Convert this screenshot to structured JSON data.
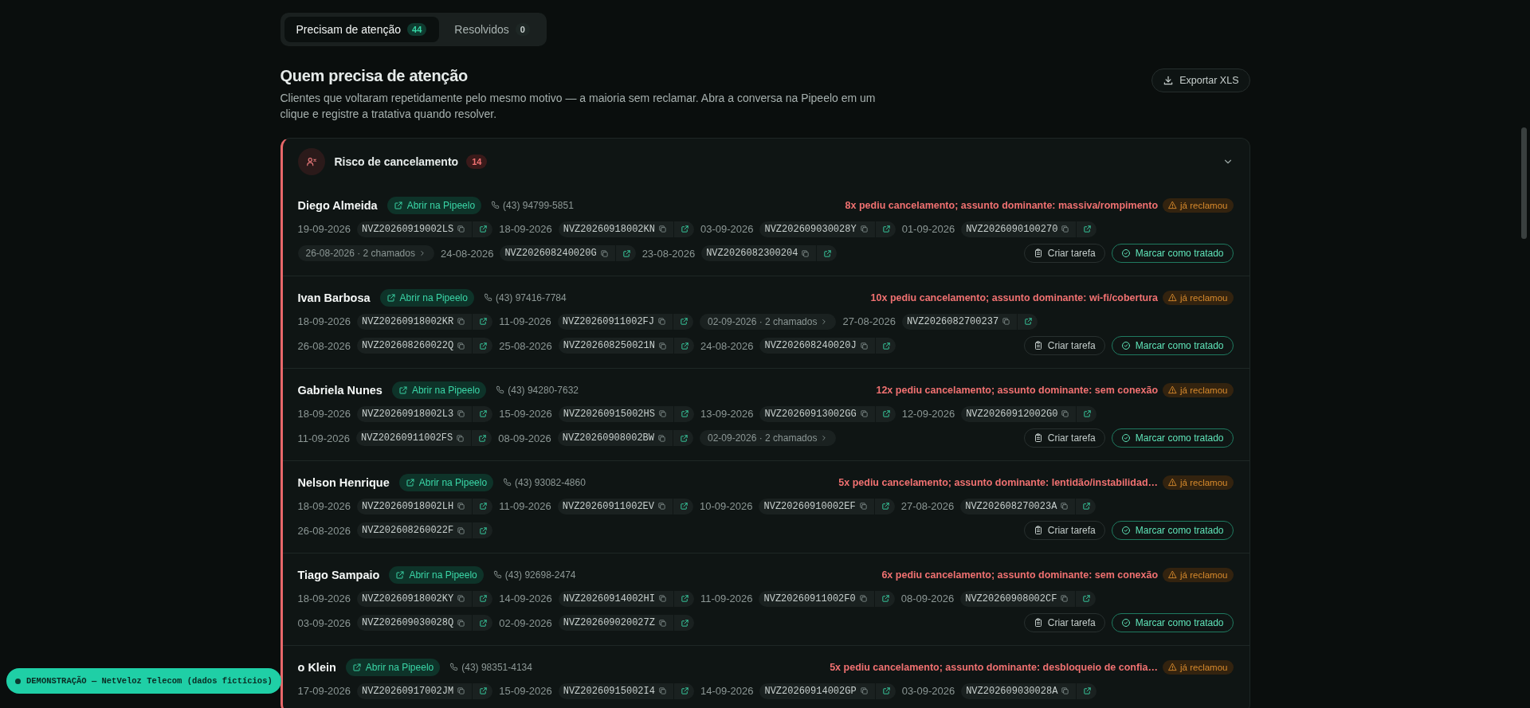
{
  "tabs": [
    {
      "label": "Precisam de atenção",
      "count": "44",
      "selected": true
    },
    {
      "label": "Resolvidos",
      "count": "0",
      "selected": false
    }
  ],
  "header": {
    "title": "Quem precisa de atenção",
    "description": "Clientes que voltaram repetidamente pelo mesmo motivo — a maioria sem reclamar. Abra a conversa na Pipeelo em um clique e registre a tratativa quando resolver.",
    "export_button": "Exportar XLS"
  },
  "group": {
    "title": "Risco de cancelamento",
    "count": "14",
    "expanded": true,
    "customers": [
      {
        "name": "Diego Almeida",
        "open_link": "Abrir na Pipeelo",
        "phone": "(43) 94799-5851",
        "alert": "8x pediu cancelamento; assunto dominante: massiva/rompimento",
        "badge": "já reclamou",
        "lines": [
          [
            {
              "kind": "ticket",
              "date": "19-09-2026",
              "id": "NVZ20260919002LS"
            },
            {
              "kind": "ticket",
              "date": "18-09-2026",
              "id": "NVZ20260918002KN"
            },
            {
              "kind": "ticket",
              "date": "03-09-2026",
              "id": "NVZ202609030028Y"
            },
            {
              "kind": "ticket",
              "date": "01-09-2026",
              "id": "NVZ2026090100270"
            }
          ],
          [
            {
              "kind": "group",
              "label": "26-08-2026 · 2 chamados"
            },
            {
              "kind": "ticket",
              "date": "24-08-2026",
              "id": "NVZ202608240020G"
            },
            {
              "kind": "ticket",
              "date": "23-08-2026",
              "id": "NVZ2026082300204"
            }
          ]
        ],
        "actions": [
          {
            "kind": "secondary",
            "label": "Criar tarefa"
          },
          {
            "kind": "primary",
            "label": "Marcar como tratado"
          }
        ]
      },
      {
        "name": "Ivan Barbosa",
        "open_link": "Abrir na Pipeelo",
        "phone": "(43) 97416-7784",
        "alert": "10x pediu cancelamento; assunto dominante: wi-fi/cobertura",
        "badge": "já reclamou",
        "lines": [
          [
            {
              "kind": "ticket",
              "date": "18-09-2026",
              "id": "NVZ20260918002KR"
            },
            {
              "kind": "ticket",
              "date": "11-09-2026",
              "id": "NVZ20260911002FJ"
            },
            {
              "kind": "group",
              "label": "02-09-2026 · 2 chamados"
            },
            {
              "kind": "ticket",
              "date": "27-08-2026",
              "id": "NVZ2026082700237"
            }
          ],
          [
            {
              "kind": "ticket",
              "date": "26-08-2026",
              "id": "NVZ202608260022Q"
            },
            {
              "kind": "ticket",
              "date": "25-08-2026",
              "id": "NVZ202608250021N"
            },
            {
              "kind": "ticket",
              "date": "24-08-2026",
              "id": "NVZ202608240020J"
            }
          ]
        ],
        "actions": [
          {
            "kind": "secondary",
            "label": "Criar tarefa"
          },
          {
            "kind": "primary",
            "label": "Marcar como tratado"
          }
        ]
      },
      {
        "name": "Gabriela Nunes",
        "open_link": "Abrir na Pipeelo",
        "phone": "(43) 94280-7632",
        "alert": "12x pediu cancelamento; assunto dominante: sem conexão",
        "badge": "já reclamou",
        "lines": [
          [
            {
              "kind": "ticket",
              "date": "18-09-2026",
              "id": "NVZ20260918002L3"
            },
            {
              "kind": "ticket",
              "date": "15-09-2026",
              "id": "NVZ20260915002HS"
            },
            {
              "kind": "ticket",
              "date": "13-09-2026",
              "id": "NVZ20260913002GG"
            },
            {
              "kind": "ticket",
              "date": "12-09-2026",
              "id": "NVZ20260912002G0"
            }
          ],
          [
            {
              "kind": "ticket",
              "date": "11-09-2026",
              "id": "NVZ20260911002FS"
            },
            {
              "kind": "ticket",
              "date": "08-09-2026",
              "id": "NVZ20260908002BW"
            },
            {
              "kind": "group",
              "label": "02-09-2026 · 2 chamados"
            }
          ]
        ],
        "actions": [
          {
            "kind": "secondary",
            "label": "Criar tarefa"
          },
          {
            "kind": "primary",
            "label": "Marcar como tratado"
          }
        ]
      },
      {
        "name": "Nelson Henrique",
        "open_link": "Abrir na Pipeelo",
        "phone": "(43) 93082-4860",
        "alert": "5x pediu cancelamento; assunto dominante: lentidão/instabilidad…",
        "badge": "já reclamou",
        "lines": [
          [
            {
              "kind": "ticket",
              "date": "18-09-2026",
              "id": "NVZ20260918002LH"
            },
            {
              "kind": "ticket",
              "date": "11-09-2026",
              "id": "NVZ20260911002EV"
            },
            {
              "kind": "ticket",
              "date": "10-09-2026",
              "id": "NVZ20260910002EF"
            },
            {
              "kind": "ticket",
              "date": "27-08-2026",
              "id": "NVZ202608270023A"
            }
          ],
          [
            {
              "kind": "ticket",
              "date": "26-08-2026",
              "id": "NVZ202608260022F"
            }
          ]
        ],
        "actions": [
          {
            "kind": "secondary",
            "label": "Criar tarefa"
          },
          {
            "kind": "primary",
            "label": "Marcar como tratado"
          }
        ]
      },
      {
        "name": "Tiago Sampaio",
        "open_link": "Abrir na Pipeelo",
        "phone": "(43) 92698-2474",
        "alert": "6x pediu cancelamento; assunto dominante: sem conexão",
        "badge": "já reclamou",
        "lines": [
          [
            {
              "kind": "ticket",
              "date": "18-09-2026",
              "id": "NVZ20260918002KY"
            },
            {
              "kind": "ticket",
              "date": "14-09-2026",
              "id": "NVZ20260914002HI"
            },
            {
              "kind": "ticket",
              "date": "11-09-2026",
              "id": "NVZ20260911002F0"
            },
            {
              "kind": "ticket",
              "date": "08-09-2026",
              "id": "NVZ20260908002CF"
            }
          ],
          [
            {
              "kind": "ticket",
              "date": "03-09-2026",
              "id": "NVZ202609030028Q"
            },
            {
              "kind": "ticket",
              "date": "02-09-2026",
              "id": "NVZ202609020027Z"
            }
          ]
        ],
        "actions": [
          {
            "kind": "secondary",
            "label": "Criar tarefa"
          },
          {
            "kind": "primary",
            "label": "Marcar como tratado"
          }
        ]
      },
      {
        "name": "o Klein",
        "open_link": "Abrir na Pipeelo",
        "phone": "(43) 98351-4134",
        "alert": "5x pediu cancelamento; assunto dominante: desbloqueio de confia…",
        "badge": "já reclamou",
        "lines": [
          [
            {
              "kind": "ticket",
              "date": "17-09-2026",
              "id": "NVZ20260917002JM"
            },
            {
              "kind": "ticket",
              "date": "15-09-2026",
              "id": "NVZ20260915002I4"
            },
            {
              "kind": "ticket",
              "date": "14-09-2026",
              "id": "NVZ20260914002GP"
            },
            {
              "kind": "ticket",
              "date": "03-09-2026",
              "id": "NVZ202609030028A"
            }
          ]
        ]
      }
    ]
  },
  "demo_banner": "DEMONSTRAÇÃO — NetVeloz Telecom (dados fictícios)"
}
